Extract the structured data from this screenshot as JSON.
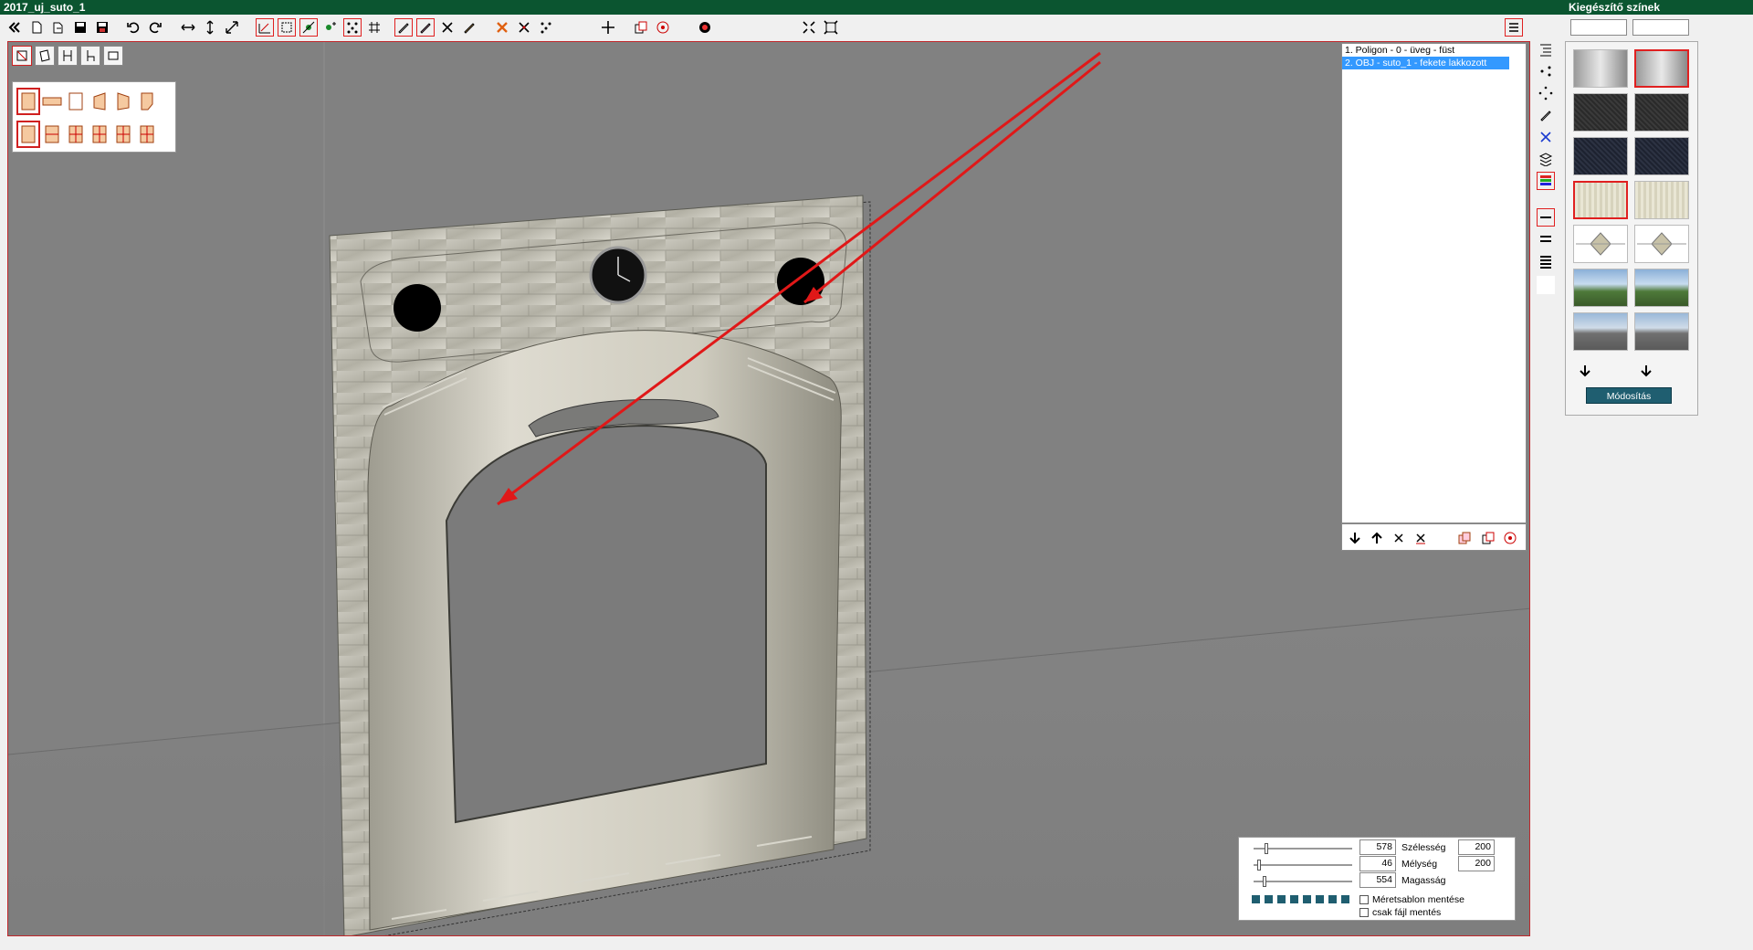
{
  "window": {
    "title": "2017_uj_suto_1",
    "panel_title": "Kiegészítő színek"
  },
  "toolbar": {
    "icons": [
      "back-double-icon",
      "new-file-icon",
      "open-file-icon",
      "save-icon",
      "save-as-icon",
      "undo-icon",
      "redo-icon",
      "resize-horizontal-icon",
      "resize-vertical-icon",
      "resize-diagonal-icon",
      "measure-icon",
      "select-frame-icon",
      "add-point-icon",
      "add-point-alt-icon",
      "points-icon",
      "grid-snap-icon",
      "pen-icon",
      "pen-selected-icon",
      "cut-path-icon",
      "pencil-icon",
      "delete-icon",
      "delete-points-icon",
      "scatter-points-icon",
      "crosshair-icon",
      "copy-icon",
      "target-icon",
      "record-icon",
      "zoom-fit-icon",
      "zoom-extents-icon",
      "menu-icon"
    ]
  },
  "objects": {
    "items": [
      {
        "label": "1. Poligon - 0 - üveg - füst",
        "selected": false
      },
      {
        "label": "2. OBJ - suto_1 - fekete lakkozott",
        "selected": true
      }
    ]
  },
  "colors_panel": {
    "field1": "",
    "field2": "",
    "modify_label": "Módosítás"
  },
  "dimensions": {
    "width_label": "Szélesség",
    "width_value": "578",
    "width_value2": "200",
    "depth_label": "Mélység",
    "depth_value": "46",
    "depth_value2": "200",
    "height_label": "Magasság",
    "height_value": "554",
    "save_template_label": "Méretsablon mentése",
    "file_only_label": "csak fájl mentés"
  },
  "accent_colors": {
    "titlebar": "#0b5530",
    "selection": "#3399ff",
    "highlight": "#e02020",
    "button": "#1f5e70"
  }
}
